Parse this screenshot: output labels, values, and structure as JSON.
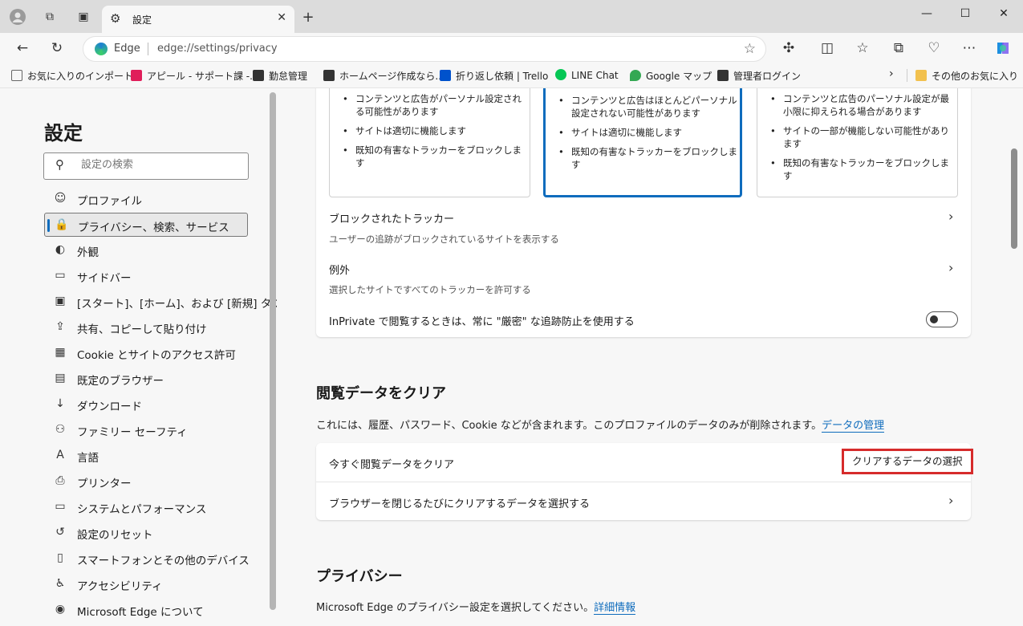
{
  "browser": {
    "tab_title": "設定",
    "address_label": "Edge",
    "url": "edge://settings/privacy",
    "window_min": "—",
    "window_max": "☐",
    "window_close": "✕"
  },
  "favorites": [
    {
      "label": "お気に入りのインポート",
      "icon_color": "#666666"
    },
    {
      "label": "アピール - サポート課 -...",
      "icon_color": "#e01e5a"
    },
    {
      "label": "勤怠管理",
      "icon_color": "#333333"
    },
    {
      "label": "ホームページ作成なら...",
      "icon_color": "#333333"
    },
    {
      "label": "折り返し依頼 | Trello",
      "icon_color": "#0052cc"
    },
    {
      "label": "LINE Chat",
      "icon_color": "#06c755"
    },
    {
      "label": "Google マップ",
      "icon_color": "#34a853"
    },
    {
      "label": "管理者ログイン",
      "icon_color": "#333333"
    }
  ],
  "favorites_other": "その他のお気に入り",
  "sidebar": {
    "title": "設定",
    "search_placeholder": "設定の検索",
    "items": [
      {
        "label": "プロファイル",
        "icon": "profile-icon",
        "glyph": "☺"
      },
      {
        "label": "プライバシー、検索、サービス",
        "icon": "lock-icon",
        "glyph": "🔒"
      },
      {
        "label": "外観",
        "icon": "palette-icon",
        "glyph": "◐"
      },
      {
        "label": "サイドバー",
        "icon": "sidebar-icon",
        "glyph": "▭"
      },
      {
        "label": "[スタート]、[ホーム]、および [新規] タブ",
        "icon": "home-tab-icon",
        "glyph": "▣"
      },
      {
        "label": "共有、コピーして貼り付け",
        "icon": "share-icon",
        "glyph": "⇪"
      },
      {
        "label": "Cookie とサイトのアクセス許可",
        "icon": "cookie-icon",
        "glyph": "▦"
      },
      {
        "label": "既定のブラウザー",
        "icon": "browser-icon",
        "glyph": "▤"
      },
      {
        "label": "ダウンロード",
        "icon": "download-icon",
        "glyph": "↓"
      },
      {
        "label": "ファミリー セーフティ",
        "icon": "family-icon",
        "glyph": "⚇"
      },
      {
        "label": "言語",
        "icon": "language-icon",
        "glyph": "A"
      },
      {
        "label": "プリンター",
        "icon": "printer-icon",
        "glyph": "⎙"
      },
      {
        "label": "システムとパフォーマンス",
        "icon": "system-icon",
        "glyph": "▭"
      },
      {
        "label": "設定のリセット",
        "icon": "reset-icon",
        "glyph": "↺"
      },
      {
        "label": "スマートフォンとその他のデバイス",
        "icon": "phone-icon",
        "glyph": "▯"
      },
      {
        "label": "アクセシビリティ",
        "icon": "accessibility-icon",
        "glyph": "♿"
      },
      {
        "label": "Microsoft Edge について",
        "icon": "edge-icon",
        "glyph": "◉"
      }
    ],
    "active_index": 1
  },
  "tracking": {
    "options": [
      {
        "bullets": [
          "コンテンツと広告がパーソナル設定される可能性があります",
          "サイトは適切に機能します",
          "既知の有害なトラッカーをブロックします"
        ]
      },
      {
        "bullets": [
          "コンテンツと広告はほとんどパーソナル設定されない可能性があります",
          "サイトは適切に機能します",
          "既知の有害なトラッカーをブロックします"
        ]
      },
      {
        "bullets": [
          "コンテンツと広告のパーソナル設定が最小限に抑えられる場合があります",
          "サイトの一部が機能しない可能性があります",
          "既知の有害なトラッカーをブロックします"
        ]
      }
    ],
    "selected_option": 1,
    "blocked_title": "ブロックされたトラッカー",
    "blocked_sub": "ユーザーの追跡がブロックされているサイトを表示する",
    "exceptions_title": "例外",
    "exceptions_sub": "選択したサイトですべてのトラッカーを許可する",
    "inprivate_label": "InPrivate で閲覧するときは、常に \"厳密\" な追跡防止を使用する",
    "inprivate_enabled": false
  },
  "clear_data": {
    "heading": "閲覧データをクリア",
    "description": "これには、履歴、パスワード、Cookie などが含まれます。このプロファイルのデータのみが削除されます。",
    "manage_link": "データの管理",
    "clear_now_label": "今すぐ閲覧データをクリア",
    "choose_button": "クリアするデータの選択",
    "on_close_label": "ブラウザーを閉じるたびにクリアするデータを選択する"
  },
  "privacy": {
    "heading": "プライバシー",
    "description": "Microsoft Edge のプライバシー設定を選択してください。",
    "details_link": "詳細情報"
  },
  "colors": {
    "accent": "#0f6cbd",
    "highlight": "#d62b2b"
  }
}
